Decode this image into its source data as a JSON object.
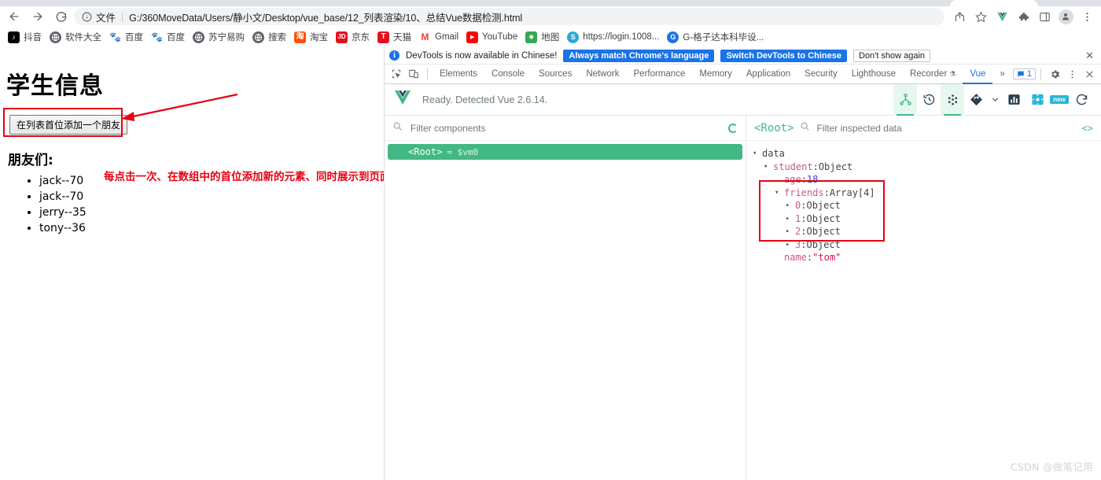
{
  "browser": {
    "nav": {
      "back_label": "Back",
      "forward_label": "Forward",
      "reload_label": "Reload"
    },
    "omnibox": {
      "info_icon": "info-circle-icon",
      "scheme_label": "文件",
      "url": "G:/360MoveData/Users/静小文/Desktop/vue_base/12_列表渲染/10、总结Vue数据检测.html"
    },
    "toolbar_icons": [
      {
        "name": "share-icon",
        "label": "Share"
      },
      {
        "name": "bookmark-star-icon",
        "label": "Bookmark this tab"
      },
      {
        "name": "vue-devtools-extension-icon",
        "label": "Vue.js devtools"
      },
      {
        "name": "extensions-puzzle-icon",
        "label": "Extensions"
      },
      {
        "name": "side-panel-icon",
        "label": "Side panel"
      },
      {
        "name": "profile-avatar-icon",
        "label": "Profile"
      },
      {
        "name": "chrome-menu-icon",
        "label": "Customize and control Google Chrome"
      }
    ],
    "bookmarks": [
      {
        "label": "抖音",
        "icon": "douyin-icon",
        "color": "#000000",
        "glyph": "♪"
      },
      {
        "label": "软件大全",
        "icon": "globe-icon",
        "color": "#5f6368",
        "glyph": ""
      },
      {
        "label": "百度",
        "icon": "baidu-icon",
        "color": "#2932e1",
        "glyph": "熊"
      },
      {
        "label": "百度",
        "icon": "baidu-icon",
        "color": "#2932e1",
        "glyph": "熊"
      },
      {
        "label": "苏宁易购",
        "icon": "globe-icon",
        "color": "#5f6368",
        "glyph": ""
      },
      {
        "label": "搜索",
        "icon": "globe-icon",
        "color": "#5f6368",
        "glyph": ""
      },
      {
        "label": "淘宝",
        "icon": "taobao-icon",
        "color": "#ff5000",
        "glyph": "淘"
      },
      {
        "label": "京东",
        "icon": "jd-icon",
        "color": "#e3101e",
        "glyph": "JD"
      },
      {
        "label": "天猫",
        "icon": "tmall-icon",
        "color": "#e3101e",
        "glyph": "T"
      },
      {
        "label": "Gmail",
        "icon": "gmail-icon",
        "color": "#ea4335",
        "glyph": "M"
      },
      {
        "label": "YouTube",
        "icon": "youtube-icon",
        "color": "#ff0000",
        "glyph": "▶"
      },
      {
        "label": "地图",
        "icon": "google-maps-icon",
        "color": "#34a853",
        "glyph": "📍"
      },
      {
        "label": "https://login.1008...",
        "icon": "globe-icon",
        "color": "#2aa9d8",
        "glyph": "S"
      },
      {
        "label": "G-格子达本科毕设...",
        "icon": "globe-icon",
        "color": "#1a73e8",
        "glyph": "G"
      }
    ]
  },
  "page": {
    "title": "学生信息",
    "add_button_label": "在列表首位添加一个朋友",
    "friends_heading": "朋友们:",
    "friends": [
      "jack--70",
      "jack--70",
      "jerry--35",
      "tony--36"
    ],
    "annotation": "每点击一次、在数组中的首位添加新的元素、同时展示到页面",
    "annotation_color": "#e60012"
  },
  "devtools": {
    "banner": {
      "message": "DevTools is now available in Chinese!",
      "primary_button": "Always match Chrome's language",
      "secondary_button": "Switch DevTools to Chinese",
      "dismiss_button": "Don't show again",
      "close_icon": "close-icon"
    },
    "tool_icons": [
      {
        "name": "inspect-element-icon"
      },
      {
        "name": "device-toolbar-icon"
      }
    ],
    "tabs": [
      {
        "label": "Elements",
        "selected": false
      },
      {
        "label": "Console",
        "selected": false
      },
      {
        "label": "Sources",
        "selected": false
      },
      {
        "label": "Network",
        "selected": false
      },
      {
        "label": "Performance",
        "selected": false
      },
      {
        "label": "Memory",
        "selected": false
      },
      {
        "label": "Application",
        "selected": false
      },
      {
        "label": "Security",
        "selected": false
      },
      {
        "label": "Lighthouse",
        "selected": false
      },
      {
        "label": "Recorder",
        "selected": false,
        "badge": "flask-icon"
      },
      {
        "label": "Vue",
        "selected": true
      }
    ],
    "more_tabs_label": "»",
    "message_count": "1",
    "right_icons": [
      {
        "name": "settings-gear-icon"
      },
      {
        "name": "devtools-more-icon"
      },
      {
        "name": "devtools-close-icon"
      }
    ]
  },
  "vue": {
    "logo_icon": "vue-logo-icon",
    "status": "Ready. Detected Vue 2.6.14.",
    "toolbar_icons": [
      {
        "name": "component-tree-icon",
        "active": true
      },
      {
        "name": "timeline-history-icon",
        "active": false
      },
      {
        "name": "vuex-dots-icon",
        "active": true
      },
      {
        "name": "routes-diamond-icon",
        "active": false
      },
      {
        "name": "chevron-down-icon",
        "active": false
      },
      {
        "name": "performance-bars-icon",
        "active": false
      },
      {
        "name": "settings-gear-icon",
        "active": false
      },
      {
        "name": "new-badge-icon",
        "active": false,
        "label": "new"
      },
      {
        "name": "refresh-icon",
        "active": false
      }
    ],
    "components": {
      "filter_placeholder": "Filter components",
      "search_icon": "search-icon",
      "loading_icon": "spinner-icon",
      "root_label": "<Root>",
      "root_vm": "= $vm0"
    },
    "inspector": {
      "root_label": "<Root>",
      "search_icon": "search-icon",
      "filter_placeholder": "Filter inspected data",
      "code_toggle": "<>",
      "tree": [
        {
          "depth": 0,
          "caret": "▾",
          "key": "data",
          "kind": "group"
        },
        {
          "depth": 1,
          "caret": "▾",
          "key": "student",
          "sep": ": ",
          "value": "Object",
          "kind": "obj"
        },
        {
          "depth": 2,
          "caret": "",
          "key": "age",
          "sep": ": ",
          "value": "18",
          "kind": "num"
        },
        {
          "depth": 2,
          "caret": "▾",
          "key": "friends",
          "sep": ": ",
          "value": "Array[4]",
          "kind": "obj"
        },
        {
          "depth": 3,
          "caret": "▸",
          "key": "0",
          "sep": ": ",
          "value": "Object",
          "kind": "obj"
        },
        {
          "depth": 3,
          "caret": "▸",
          "key": "1",
          "sep": ": ",
          "value": "Object",
          "kind": "obj"
        },
        {
          "depth": 3,
          "caret": "▸",
          "key": "2",
          "sep": ": ",
          "value": "Object",
          "kind": "obj"
        },
        {
          "depth": 3,
          "caret": "▸",
          "key": "3",
          "sep": ": ",
          "value": "Object",
          "kind": "obj"
        },
        {
          "depth": 2,
          "caret": "",
          "key": "name",
          "sep": ": ",
          "value": "\"tom\"",
          "kind": "str"
        }
      ]
    }
  },
  "watermark": "CSDN @做笔记用",
  "colors": {
    "vue_green": "#42b883",
    "chrome_blue": "#1a73e8",
    "annotation_red": "#e60012"
  }
}
